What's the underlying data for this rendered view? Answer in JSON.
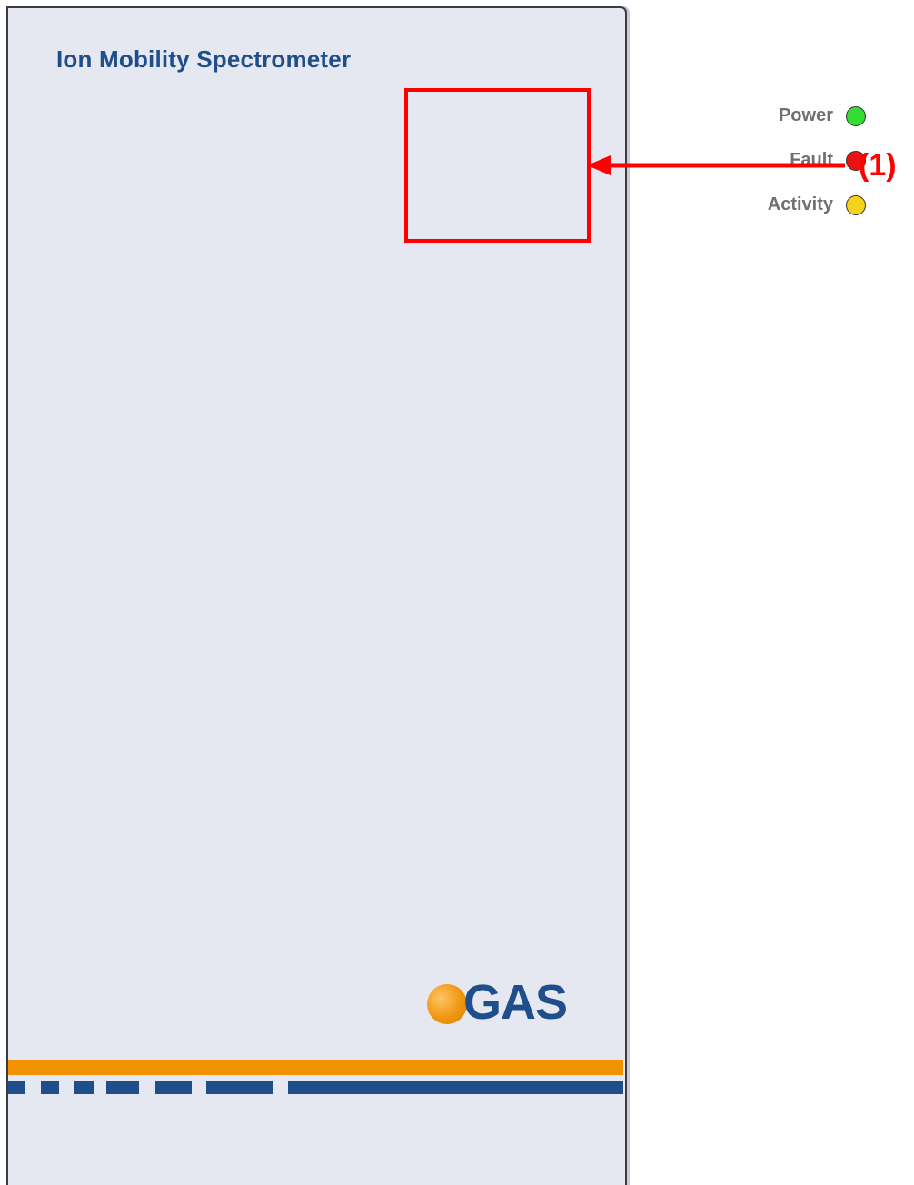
{
  "device": {
    "title": "Ion Mobility Spectrometer",
    "panel_color": "#e5e8f0",
    "title_color": "#1e4f8c"
  },
  "indicators": [
    {
      "label": "Power",
      "color": "#33dd33",
      "icon": "green-led-icon"
    },
    {
      "label": "Fault",
      "color": "#ee1111",
      "icon": "red-led-icon"
    },
    {
      "label": "Activity",
      "color": "#f7d21a",
      "icon": "yellow-led-icon"
    }
  ],
  "callout": {
    "label": "(1)",
    "color": "#ff0000",
    "icon": "left-arrow-icon"
  },
  "brand": {
    "logo_text": "GAS",
    "ball_color": "#f39200",
    "text_color": "#1e4f8c"
  },
  "stripes": {
    "orange": "#f39200",
    "blue": "#1e4f8c"
  }
}
